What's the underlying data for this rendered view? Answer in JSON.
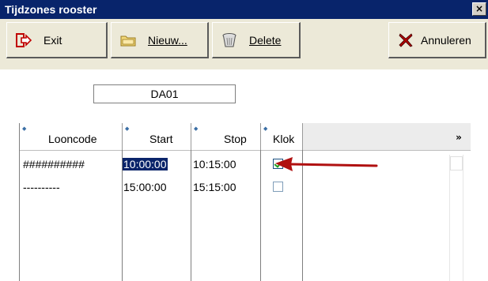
{
  "window": {
    "title": "Tijdzones rooster",
    "close_glyph": "×"
  },
  "toolbar": {
    "exit_label": "Exit",
    "nieuw_label": "Nieuw...",
    "delete_label": "Delete",
    "annuleren_label": "Annuleren"
  },
  "code_field": {
    "value": "DA01"
  },
  "grid": {
    "columns": [
      "Looncode",
      "Start",
      "Stop",
      "Klok"
    ],
    "more_glyph": "»",
    "rows": [
      {
        "looncode": "##########",
        "start": "10:00:00",
        "stop": "10:15:00",
        "klok": true,
        "selected_cell": "start"
      },
      {
        "looncode": "----------",
        "start": "15:00:00",
        "stop": "15:15:00",
        "klok": false
      }
    ]
  },
  "colors": {
    "titlebar": "#08246b",
    "selection": "#0a246a",
    "annotation_arrow": "#b01010"
  }
}
